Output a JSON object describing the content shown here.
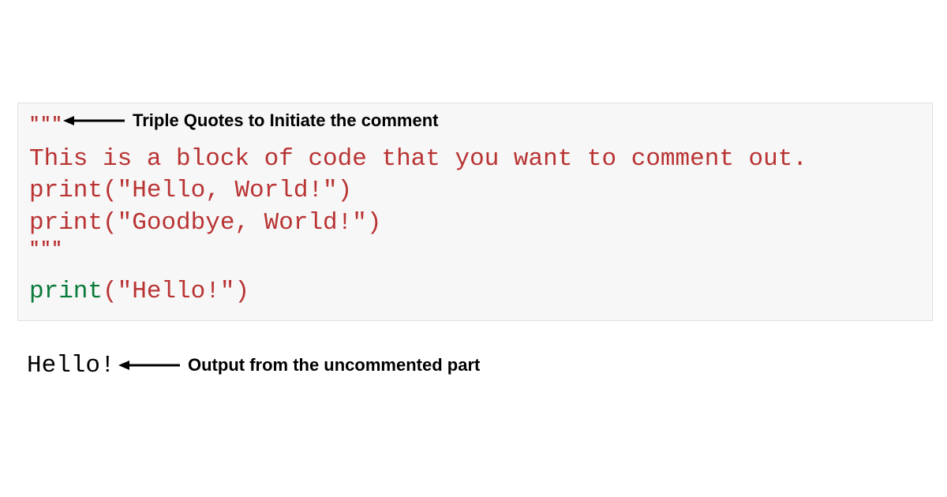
{
  "code": {
    "open_quotes": "\"\"\"",
    "line1": "This is a block of code that you want to comment out.",
    "line2_print": "print",
    "line2_rest": "(\"Hello, World!\")",
    "line3_print": "print",
    "line3_rest": "(\"Goodbye, World!\")",
    "close_quotes": "\"\"\"",
    "line4_print": "print",
    "line4_rest": "(\"Hello!\")"
  },
  "output": {
    "text": "Hello!"
  },
  "annotations": {
    "top": "Triple Quotes to Initiate the comment",
    "bottom": "Output from the uncommented part"
  }
}
